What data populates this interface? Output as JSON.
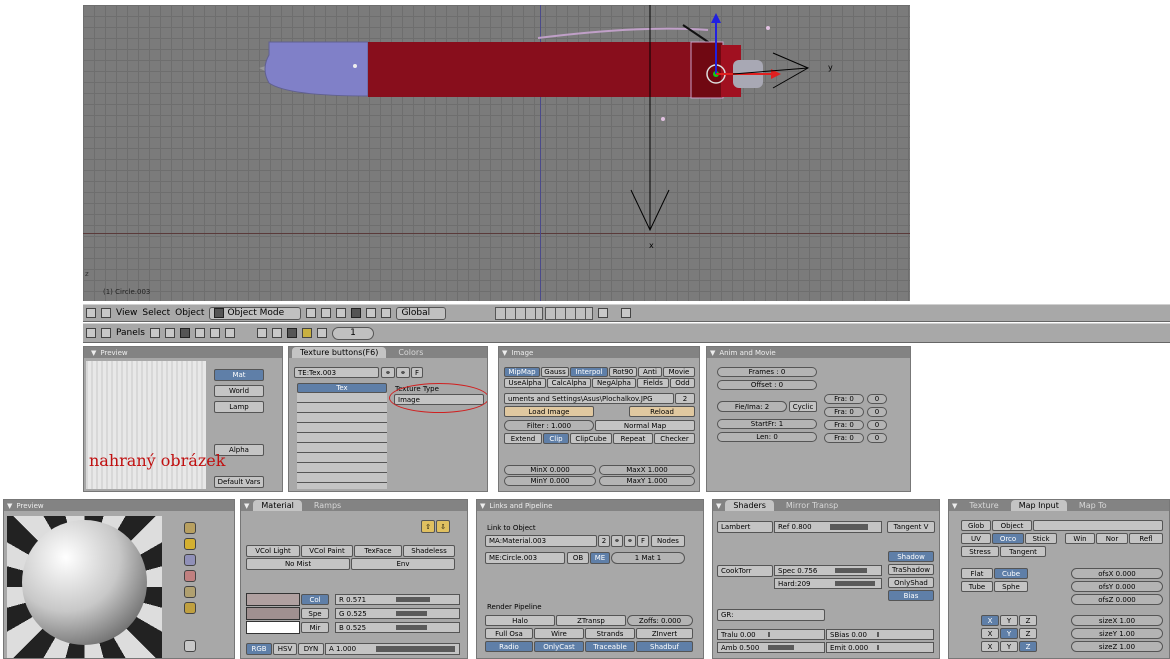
{
  "viewport": {
    "object_label": "(1) Circle.003",
    "axis_y": "y",
    "axis_x": "x",
    "axis_z": "z"
  },
  "header": {
    "menus": [
      "View",
      "Select",
      "Object"
    ],
    "mode": "Object Mode",
    "orientation": "Global"
  },
  "panels_bar": {
    "label": "Panels",
    "frame": "1"
  },
  "preview": {
    "title": "Preview",
    "buttons": [
      "Mat",
      "World",
      "Lamp",
      "Alpha",
      "Default Vars"
    ],
    "overlay_text": "nahraný obrázek"
  },
  "texture": {
    "tab_active": "Texture buttons(F6)",
    "tab_inactive": "Colors",
    "tex_name": "TE:Tex.003",
    "f_label": "F",
    "tex_header": "Tex",
    "type_label": "Texture Type",
    "type_value": "Image"
  },
  "image": {
    "title": "Image",
    "row1": [
      "MipMap",
      "Gauss",
      "Interpol",
      "Rot90",
      "Anti",
      "Movie"
    ],
    "row2": [
      "UseAlpha",
      "CalcAlpha",
      "NegAlpha",
      "Fields",
      "Odd"
    ],
    "path": "uments and Settings\\Asus\\Plochalkov.JPG",
    "users": "2",
    "load": "Load Image",
    "reload": "Reload",
    "filter": "Filter : 1.000",
    "normal_map": "Normal Map",
    "row_ext": [
      "Extend",
      "Clip",
      "ClipCube",
      "Repeat",
      "Checker"
    ],
    "minx": "MinX 0.000",
    "maxx": "MaxX 1.000",
    "miny": "MinY 0.000",
    "maxy": "MaxY 1.000"
  },
  "anim": {
    "title": "Anim and Movie",
    "frames": "Frames : 0",
    "offset": "Offset : 0",
    "fie": "Fie/Ima: 2",
    "cyclic": "Cyclic",
    "startfr": "StartFr: 1",
    "len": "Len: 0",
    "fra": [
      "Fra: 0",
      "Fra: 0",
      "Fra: 0",
      "Fra: 0"
    ],
    "zero": "0"
  },
  "material_preview": {
    "title": "Preview"
  },
  "material": {
    "tab_active": "Material",
    "tab_inactive": "Ramps",
    "vcol_light": "VCol Light",
    "vcol_paint": "VCol Paint",
    "texface": "TexFace",
    "shadeless": "Shadeless",
    "no_mist": "No Mist",
    "env": "Env",
    "col": "Col",
    "spe": "Spe",
    "mir": "Mir",
    "r": "R 0.571",
    "g": "G 0.525",
    "b": "B 0.525",
    "rgb": "RGB",
    "hsv": "HSV",
    "dyn": "DYN",
    "a": "A 1.000",
    "col_value": 0.571,
    "spe_value": 0.525,
    "mir_value": 0.525,
    "alpha_value": 1.0
  },
  "links": {
    "title": "Links and Pipeline",
    "link_to": "Link to Object",
    "ma": "MA:Material.003",
    "ma_users": "2",
    "f": "F",
    "nodes": "Nodes",
    "me": "ME:Circle.003",
    "ob": "OB",
    "me_btn": "ME",
    "mat_count": "1 Mat 1",
    "render_pipeline": "Render Pipeline",
    "halo": "Halo",
    "ztransp": "ZTransp",
    "zoffs": "Zoffs: 0.000",
    "full_osa": "Full Osa",
    "wire": "Wire",
    "strands": "Strands",
    "zinvert": "ZInvert",
    "radio": "Radio",
    "onlycast": "OnlyCast",
    "traceable": "Traceable",
    "shadbuf": "Shadbuf"
  },
  "shaders": {
    "tab_active": "Shaders",
    "tab_inactive": "Mirror Transp",
    "lambert": "Lambert",
    "ref": "Ref  0.800",
    "tangent": "Tangent V",
    "shadow": "Shadow",
    "cooktorr": "CookTorr",
    "spec": "Spec 0.756",
    "hard": "Hard:209",
    "trashadow": "TraShadow",
    "onlyshad": "OnlyShad",
    "bias": "Bias",
    "gr": "GR:",
    "tralu": "Tralu 0.00",
    "sbias": "SBias 0.00",
    "amb": "Amb 0.500",
    "emit": "Emit 0.000",
    "ref_value": 0.8,
    "spec_value": 0.756,
    "amb_value": 0.5
  },
  "map_input": {
    "tab_texture": "Texture",
    "tab_active": "Map Input",
    "tab_mapto": "Map To",
    "glob": "Glob",
    "object": "Object",
    "uv": "UV",
    "orco": "Orco",
    "stick": "Stick",
    "win": "Win",
    "nor": "Nor",
    "refl": "Refl",
    "stress": "Stress",
    "tangent": "Tangent",
    "flat": "Flat",
    "cube": "Cube",
    "tube": "Tube",
    "sphe": "Sphe",
    "ofsx": "ofsX 0.000",
    "ofsy": "ofsY 0.000",
    "ofsz": "ofsZ 0.000",
    "xyz": [
      "X",
      "Y",
      "Z"
    ],
    "sizex": "sizeX 1.00",
    "sizey": "sizeY 1.00",
    "sizez": "sizeZ 1.00"
  }
}
